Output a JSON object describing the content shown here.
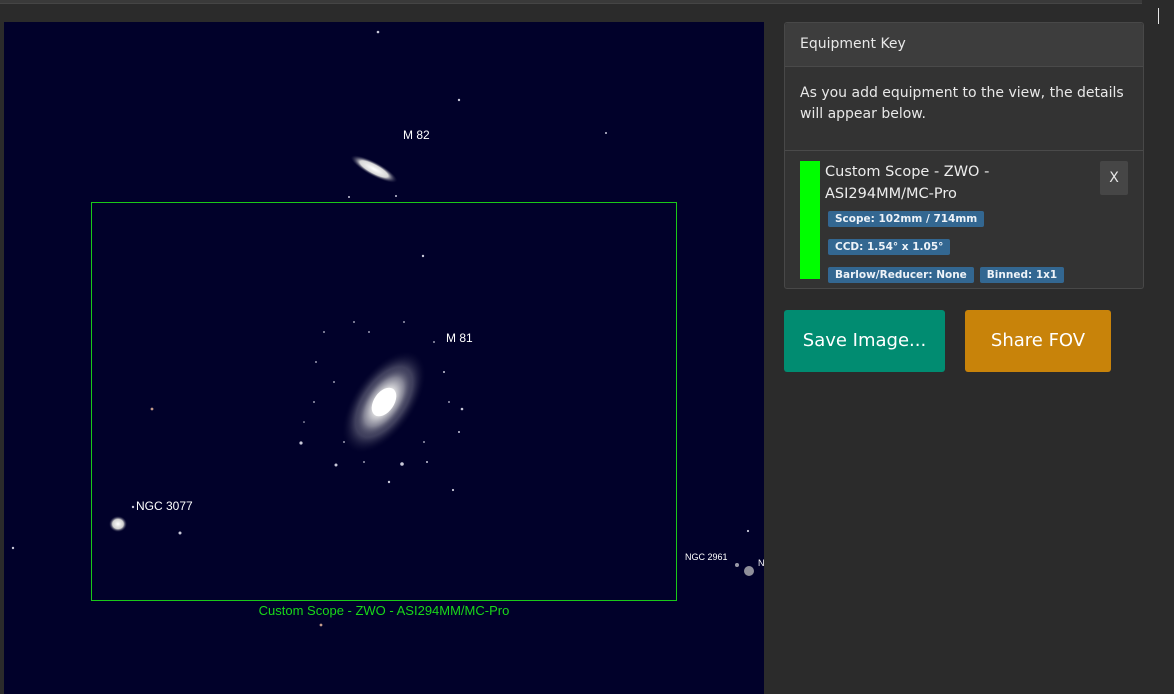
{
  "sky": {
    "objects": {
      "m82": "M 82",
      "m81": "M 81",
      "ngc3077": "NGC 3077",
      "ngc2961": "NGC 2961",
      "edge_label": "N"
    },
    "fov_label": "Custom Scope - ZWO - ASI294MM/MC-Pro",
    "fov_color": "#19c919"
  },
  "equipment_key": {
    "title": "Equipment Key",
    "intro": "As you add equipment to the view, the details will appear below.",
    "items": [
      {
        "name": "Custom Scope - ZWO - ASI294MM/MC-Pro",
        "color": "#00ff00",
        "badges": [
          "Scope: 102mm / 714mm",
          "CCD: 1.54° x 1.05°",
          "Barlow/Reducer: None",
          "Binned: 1x1"
        ],
        "remove_label": "X"
      }
    ]
  },
  "actions": {
    "save_label": "Save Image...",
    "share_label": "Share FOV",
    "save_color": "#018c71",
    "share_color": "#c8830a"
  }
}
